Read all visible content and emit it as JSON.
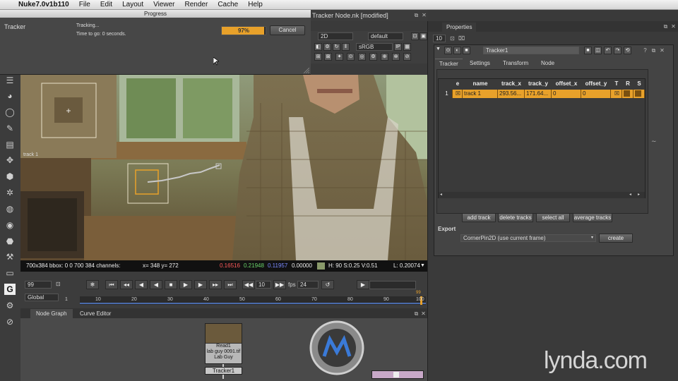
{
  "menubar": {
    "app_name": "Nuke7.0v1b110",
    "items": [
      "File",
      "Edit",
      "Layout",
      "Viewer",
      "Render",
      "Cache",
      "Help"
    ]
  },
  "progress_dialog": {
    "title": "Progress",
    "label": "Tracker",
    "status": "Tracking...",
    "time_to_go": "Time to go: 0 seconds.",
    "percent_text": "97%",
    "percent_value": 97,
    "cancel_label": "Cancel"
  },
  "viewer": {
    "window_title": "Tracker Node.nk [modified]",
    "view_mode": "2D",
    "lut": "default",
    "colorspace": "sRGB",
    "track_label": "track 1",
    "info": {
      "format": "700x384 bbox: 0 0 700 384 channels:",
      "xy": "x= 348 y= 272",
      "r": "0.16516",
      "g": "0.21948",
      "b": "0.11957",
      "a": "0.00000",
      "hsv": "H: 90 S:0.25 V:0.51",
      "l": "L: 0.20074"
    }
  },
  "timeline": {
    "current_frame": "99",
    "increment": "10",
    "fps_label": "fps",
    "fps_value": "24",
    "range_mode": "Global",
    "ticks": [
      "1",
      "10",
      "20",
      "30",
      "40",
      "50",
      "60",
      "70",
      "80",
      "90",
      "100"
    ],
    "end_marker": "99"
  },
  "nodegraph": {
    "tabs": [
      "Node Graph",
      "Curve Editor"
    ],
    "read_node": {
      "line1": "Read1",
      "line2": "lab guy 0091.tif",
      "line3": "Lab Guy"
    },
    "tracker_node": "Tracker1"
  },
  "properties": {
    "title": "Properties",
    "max_panels": "10",
    "node_name": "Tracker1",
    "tabs": [
      "Tracker",
      "Settings",
      "Transform",
      "Node"
    ],
    "table_headers": [
      "e",
      "name",
      "track_x",
      "track_y",
      "offset_x",
      "offset_y",
      "T",
      "R",
      "S"
    ],
    "row": {
      "index": "1",
      "name": "track 1",
      "track_x": "293.56...",
      "track_y": "171.64...",
      "offset_x": "0",
      "offset_y": "0"
    },
    "buttons": [
      "add track",
      "delete tracks",
      "select all",
      "average tracks"
    ],
    "export_label": "Export",
    "export_value": "CornerPin2D (use current frame)",
    "create_label": "create"
  },
  "watermark": "lynda.com"
}
